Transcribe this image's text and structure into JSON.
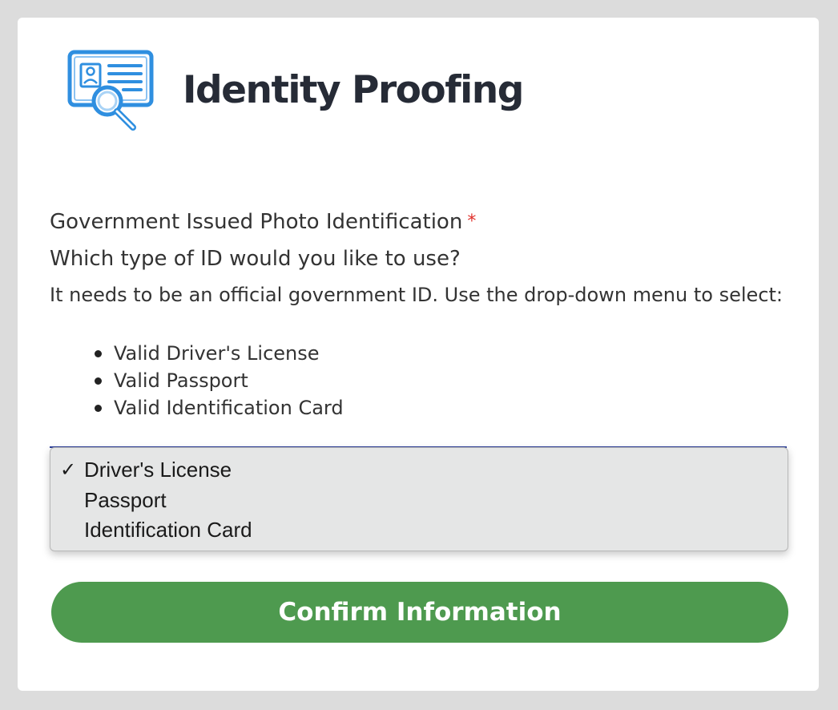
{
  "header": {
    "logo_icon": "id-card-search-icon",
    "title": "Identity Proofing"
  },
  "form": {
    "field_label": "Government Issued Photo Identification",
    "required_marker": "*",
    "question": "Which type of ID would you like to use?",
    "instructions": "It needs to be an official government ID. Use the drop-down menu to select:",
    "accepted_ids": [
      "Valid Driver's License",
      "Valid Passport",
      "Valid Identification Card"
    ],
    "id_type_select": {
      "selected": "Driver's License",
      "checkmark": "✓",
      "options": [
        "Driver's License",
        "Passport",
        "Identification Card"
      ]
    },
    "confirm_label": "Confirm Information"
  },
  "colors": {
    "page_background": "#dcdcdc",
    "card_background": "#ffffff",
    "brand_text": "#262b36",
    "required": "#e0312b",
    "button_green": "#4e9a4f",
    "logo_blue": "#2f8fe0",
    "dropdown_background": "#e5e6e6"
  }
}
